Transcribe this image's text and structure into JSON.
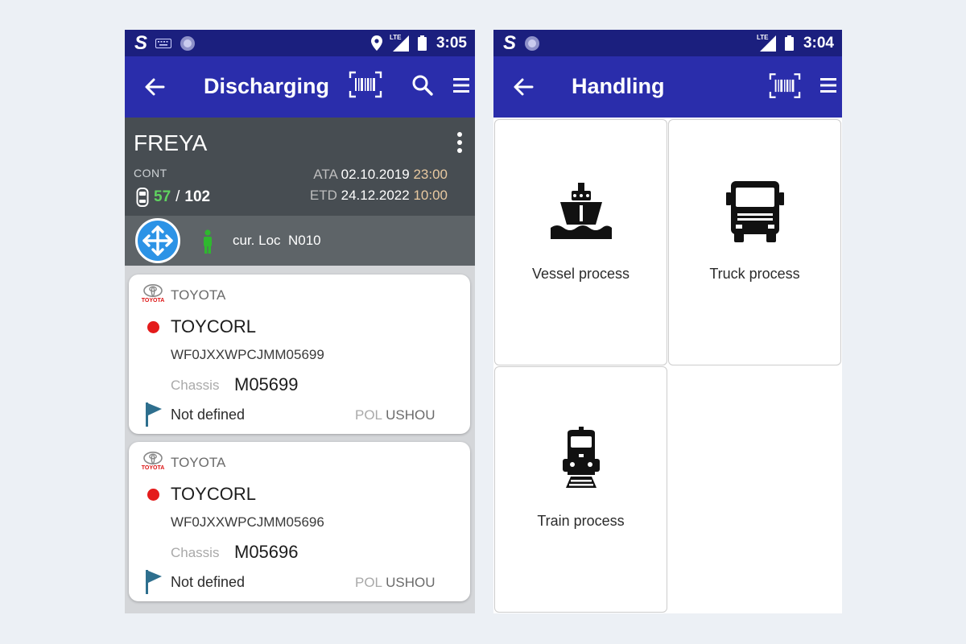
{
  "left_screen": {
    "status": {
      "time": "3:05",
      "network": "LTE"
    },
    "title": "Discharging",
    "vessel": {
      "name": "FREYA",
      "type_label": "CONT",
      "done": "57",
      "separator": "/",
      "total": "102",
      "ata_label": "ATA",
      "ata_date": "02.10.2019",
      "ata_time": "23:00",
      "etd_label": "ETD",
      "etd_date": "24.12.2022",
      "etd_time": "10:00"
    },
    "location": {
      "label": "cur. Loc",
      "value": "N010"
    },
    "cards": [
      {
        "logo_text": "TOYOTA",
        "brand": "TOYOTA",
        "model": "TOYCORL",
        "vin": "WF0JXXWPCJMM05699",
        "chassis_label": "Chassis",
        "chassis": "M05699",
        "status": "Not defined",
        "pol_label": "POL",
        "pol": "USHOU"
      },
      {
        "logo_text": "TOYOTA",
        "brand": "TOYOTA",
        "model": "TOYCORL",
        "vin": "WF0JXXWPCJMM05696",
        "chassis_label": "Chassis",
        "chassis": "M05696",
        "status": "Not defined",
        "pol_label": "POL",
        "pol": "USHOU"
      }
    ]
  },
  "right_screen": {
    "status": {
      "time": "3:04",
      "network": "LTE"
    },
    "title": "Handling",
    "tiles": [
      {
        "label": "Vessel process",
        "icon": "ship-icon"
      },
      {
        "label": "Truck process",
        "icon": "truck-icon"
      },
      {
        "label": "Train process",
        "icon": "train-icon"
      }
    ]
  },
  "colors": {
    "status_bar": "#1b1f7e",
    "app_bar": "#2a2dab",
    "vessel_header": "#474d52",
    "location_bar": "#5e6468",
    "done_count": "#5fd35f",
    "accent_blue": "#2c93e6",
    "status_dot": "#e41b1b",
    "flag": "#2e6f8e"
  }
}
